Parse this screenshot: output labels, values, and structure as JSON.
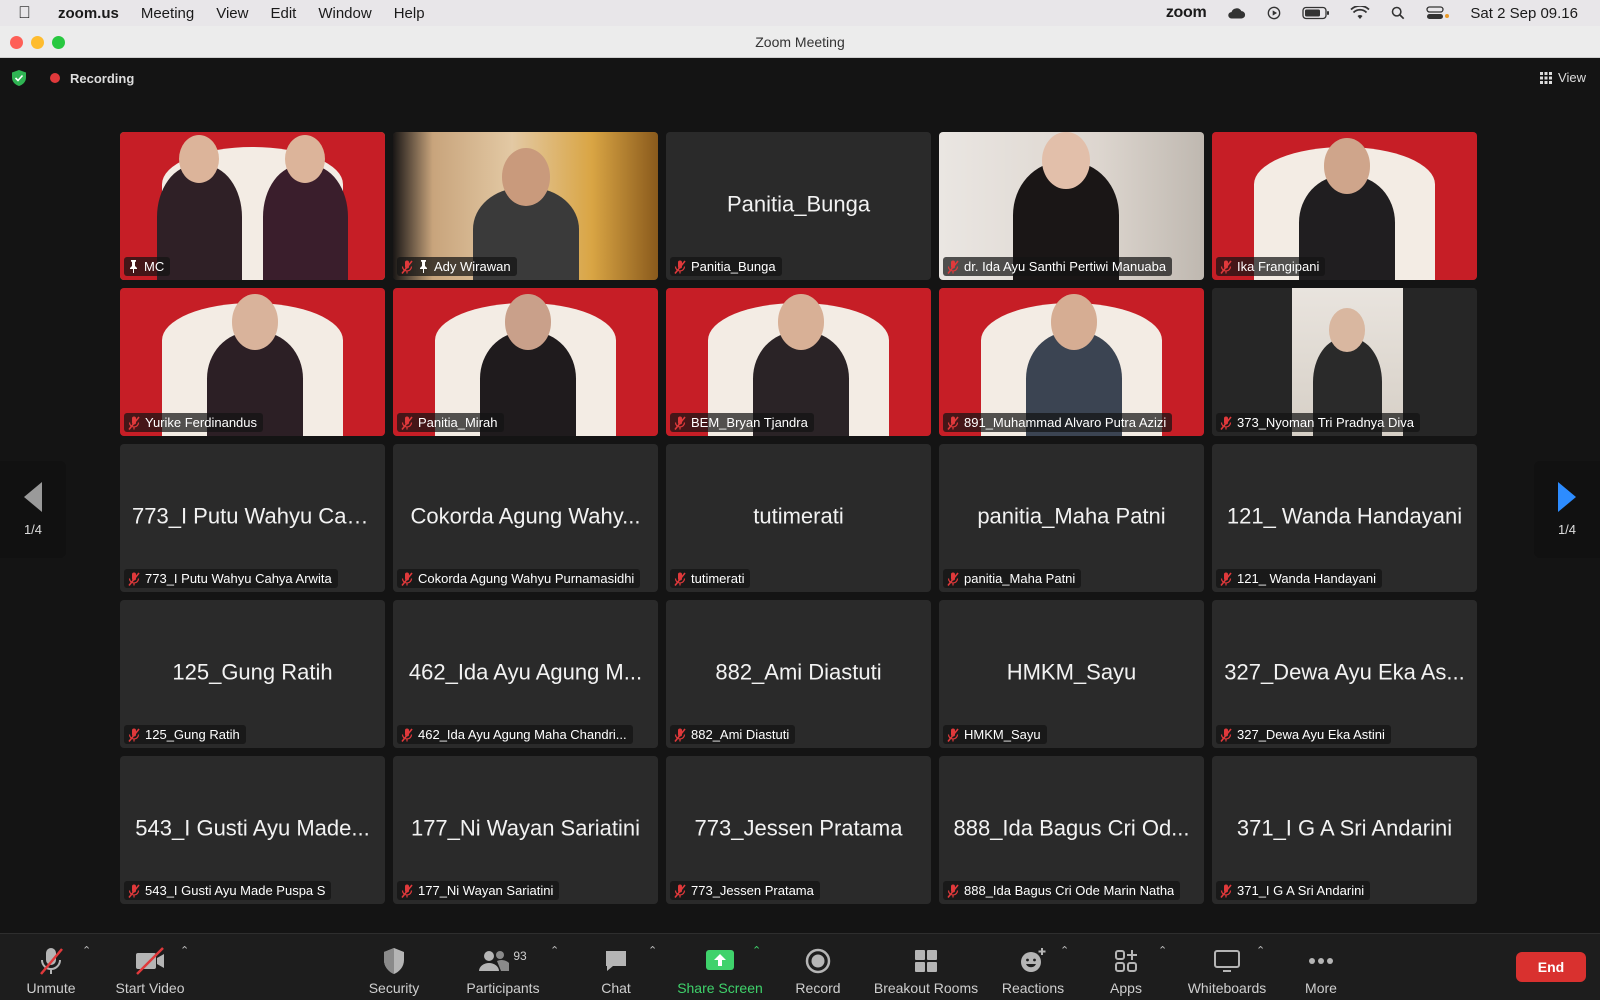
{
  "menubar": {
    "app": "zoom.us",
    "items": [
      "Meeting",
      "View",
      "Edit",
      "Window",
      "Help"
    ],
    "zoom_logo": "zoom",
    "datetime": "Sat 2 Sep  09.16"
  },
  "window": {
    "title": "Zoom Meeting"
  },
  "meeting": {
    "recording_label": "Recording",
    "view_label": "View",
    "page_indicator_left": "1/4",
    "page_indicator_right": "1/4"
  },
  "tiles": [
    {
      "label": "MC",
      "big": "",
      "video": "stage-two",
      "pinned": true,
      "muted": false,
      "active": true
    },
    {
      "label": "Ady Wirawan",
      "big": "",
      "video": "room",
      "pinned": true,
      "muted": true
    },
    {
      "label": "Panitia_Bunga",
      "big": "Panitia_Bunga",
      "video": "none",
      "muted": true
    },
    {
      "label": "dr. Ida Ayu Santhi Pertiwi Manuaba",
      "big": "",
      "video": "room2",
      "muted": true
    },
    {
      "label": "Ika Frangipani",
      "big": "",
      "video": "stage",
      "muted": true
    },
    {
      "label": "Yurike Ferdinandus",
      "big": "",
      "video": "stage",
      "muted": true
    },
    {
      "label": "Panitia_Mirah",
      "big": "",
      "video": "stage",
      "muted": true
    },
    {
      "label": "BEM_Bryan Tjandra",
      "big": "",
      "video": "stage",
      "muted": true
    },
    {
      "label": "891_Muhammad Alvaro Putra Azizi",
      "big": "",
      "video": "stage",
      "muted": true
    },
    {
      "label": "373_Nyoman Tri Pradnya Diva",
      "big": "",
      "video": "portrait",
      "muted": true
    },
    {
      "label": "773_I Putu Wahyu Cahya Arwita",
      "big": "773_I Putu Wahyu Cah...",
      "video": "none",
      "muted": true
    },
    {
      "label": "Cokorda Agung Wahyu Purnamasidhi",
      "big": "Cokorda Agung Wahy...",
      "video": "none",
      "muted": true
    },
    {
      "label": "tutimerati",
      "big": "tutimerati",
      "video": "none",
      "muted": true
    },
    {
      "label": "panitia_Maha Patni",
      "big": "panitia_Maha Patni",
      "video": "none",
      "muted": true
    },
    {
      "label": "121_ Wanda Handayani",
      "big": "121_ Wanda Handayani",
      "video": "none",
      "muted": true
    },
    {
      "label": "125_Gung Ratih",
      "big": "125_Gung Ratih",
      "video": "none",
      "muted": true
    },
    {
      "label": "462_Ida Ayu Agung Maha Chandri...",
      "big": "462_Ida Ayu Agung M...",
      "video": "none",
      "muted": true
    },
    {
      "label": "882_Ami Diastuti",
      "big": "882_Ami Diastuti",
      "video": "none",
      "muted": true
    },
    {
      "label": "HMKM_Sayu",
      "big": "HMKM_Sayu",
      "video": "none",
      "muted": true
    },
    {
      "label": "327_Dewa Ayu Eka Astini",
      "big": "327_Dewa Ayu Eka As...",
      "video": "none",
      "muted": true
    },
    {
      "label": "543_I Gusti Ayu Made Puspa S",
      "big": "543_I Gusti Ayu Made...",
      "video": "none",
      "muted": true
    },
    {
      "label": "177_Ni Wayan Sariatini",
      "big": "177_Ni Wayan Sariatini",
      "video": "none",
      "muted": true
    },
    {
      "label": "773_Jessen Pratama",
      "big": "773_Jessen Pratama",
      "video": "none",
      "muted": true
    },
    {
      "label": "888_Ida Bagus Cri Ode Marin Natha",
      "big": "888_Ida Bagus Cri Od...",
      "video": "none",
      "muted": true
    },
    {
      "label": "371_I G A Sri Andarini",
      "big": "371_I G A Sri Andarini",
      "video": "none",
      "muted": true
    }
  ],
  "toolbar": {
    "unmute": "Unmute",
    "start_video": "Start Video",
    "security": "Security",
    "participants": "Participants",
    "participants_count": "93",
    "chat": "Chat",
    "share_screen": "Share Screen",
    "record": "Record",
    "breakout_rooms": "Breakout Rooms",
    "reactions": "Reactions",
    "apps": "Apps",
    "whiteboards": "Whiteboards",
    "more": "More",
    "end": "End"
  },
  "colors": {
    "accent_green": "#3fd26b",
    "end_red": "#d9312f",
    "active_border": "#46d160",
    "recording_red": "#e0393b"
  }
}
